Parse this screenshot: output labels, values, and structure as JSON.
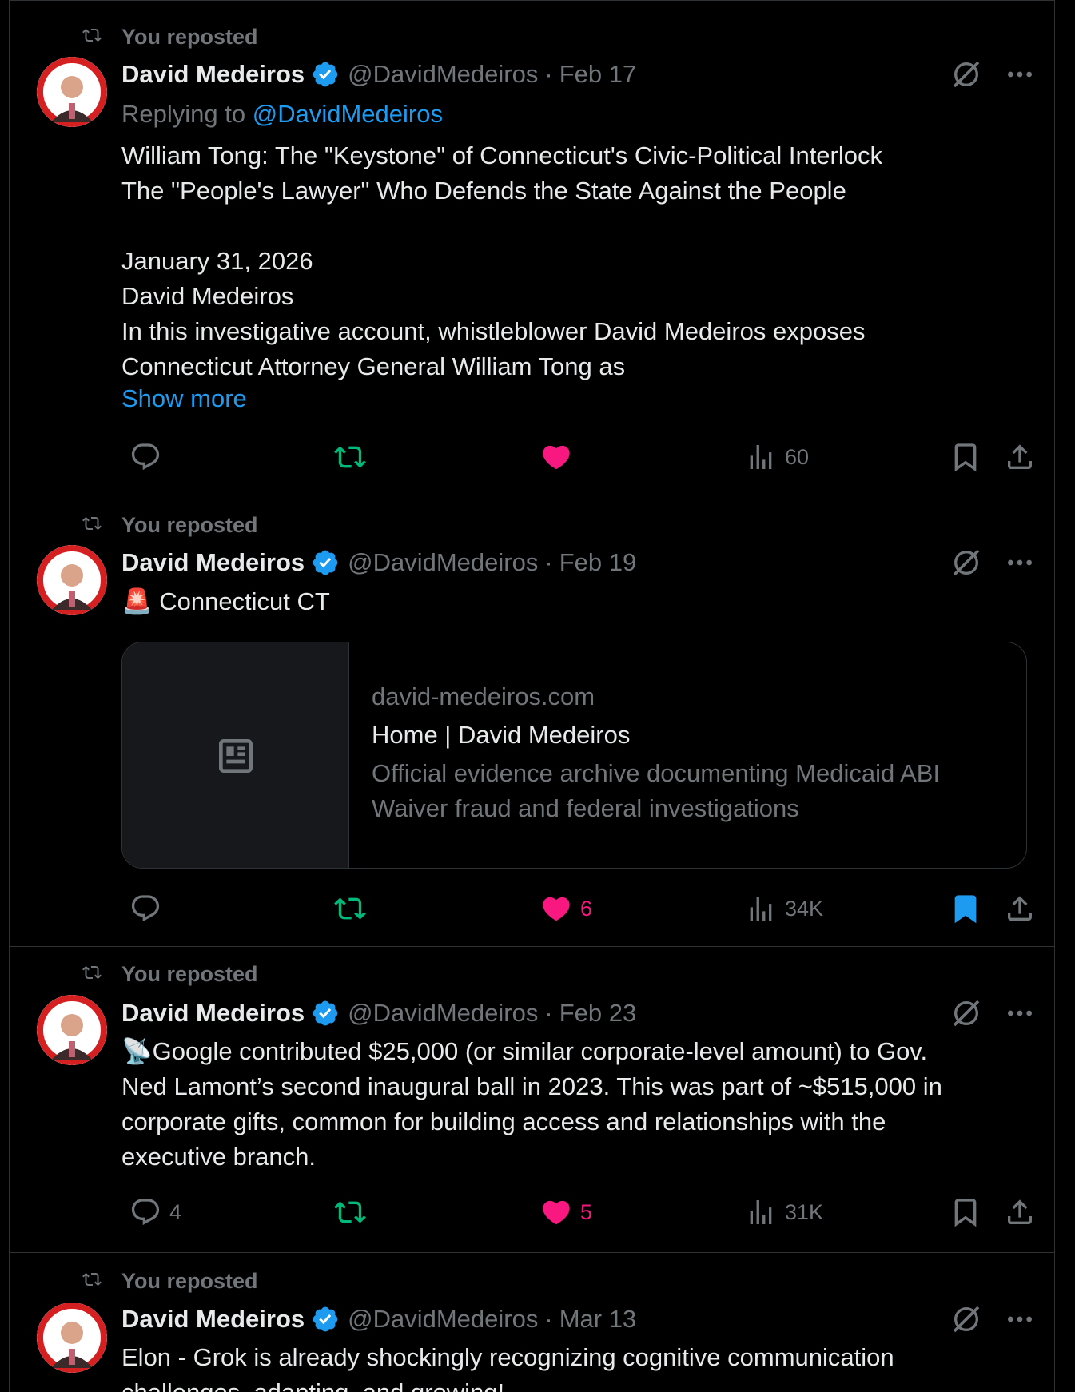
{
  "colors": {
    "background": "#000000",
    "text": "#e7e9ea",
    "muted": "#71767b",
    "link": "#1d9bf0",
    "like": "#f91880",
    "repost": "#00ba7c",
    "border": "#2f3336"
  },
  "icons": {
    "repost_indicator": "repost-icon",
    "verified": "verified-badge-icon",
    "grok": "grok-icon",
    "more": "more-icon",
    "reply": "reply-icon",
    "like": "heart-icon",
    "views": "views-icon",
    "bookmark": "bookmark-icon",
    "share": "share-icon",
    "card_placeholder": "article-icon"
  },
  "posts": [
    {
      "repost_label": "You reposted",
      "author_name": "David Medeiros",
      "handle": "@DavidMedeiros",
      "separator": "·",
      "date": "Feb 17",
      "replying_prefix": "Replying to",
      "replying_handle": "@DavidMedeiros",
      "text_lines": [
        "William Tong: The \"Keystone\" of Connecticut's Civic-Political Interlock",
        "The \"People's Lawyer\" Who Defends the State Against the People",
        "",
        "January 31, 2026",
        "David Medeiros",
        "In this investigative account, whistleblower David Medeiros exposes",
        "Connecticut Attorney General William Tong as"
      ],
      "show_more": "Show more",
      "reply_count": "",
      "repost_active": true,
      "like_active": true,
      "like_count": "",
      "view_count": "60",
      "bookmarked": false
    },
    {
      "repost_label": "You reposted",
      "author_name": "David Medeiros",
      "handle": "@DavidMedeiros",
      "separator": "·",
      "date": "Feb 19",
      "text_lines": [
        "🚨 Connecticut CT"
      ],
      "card": {
        "domain": "david-medeiros.com",
        "title": "Home | David Medeiros",
        "description": "Official evidence archive documenting Medicaid ABI Waiver fraud and federal investigations"
      },
      "reply_count": "",
      "repost_active": true,
      "like_active": true,
      "like_count": "6",
      "view_count": "34K",
      "bookmarked": true
    },
    {
      "repost_label": "You reposted",
      "author_name": "David Medeiros",
      "handle": "@DavidMedeiros",
      "separator": "·",
      "date": "Feb 23",
      "text_lines": [
        "📡Google contributed $25,000 (or similar corporate-level amount) to Gov.",
        "Ned Lamont’s second inaugural ball in 2023. This was part of ~$515,000 in",
        "corporate gifts, common for building access and relationships with the",
        "executive branch."
      ],
      "reply_count": "4",
      "repost_active": true,
      "like_active": true,
      "like_count": "5",
      "view_count": "31K",
      "bookmarked": false
    },
    {
      "repost_label": "You reposted",
      "author_name": "David Medeiros",
      "handle": "@DavidMedeiros",
      "separator": "·",
      "date": "Mar 13",
      "text_lines": [
        "Elon - Grok is already shockingly recognizing cognitive communication",
        "challenges, adapting, and growing!"
      ]
    }
  ]
}
